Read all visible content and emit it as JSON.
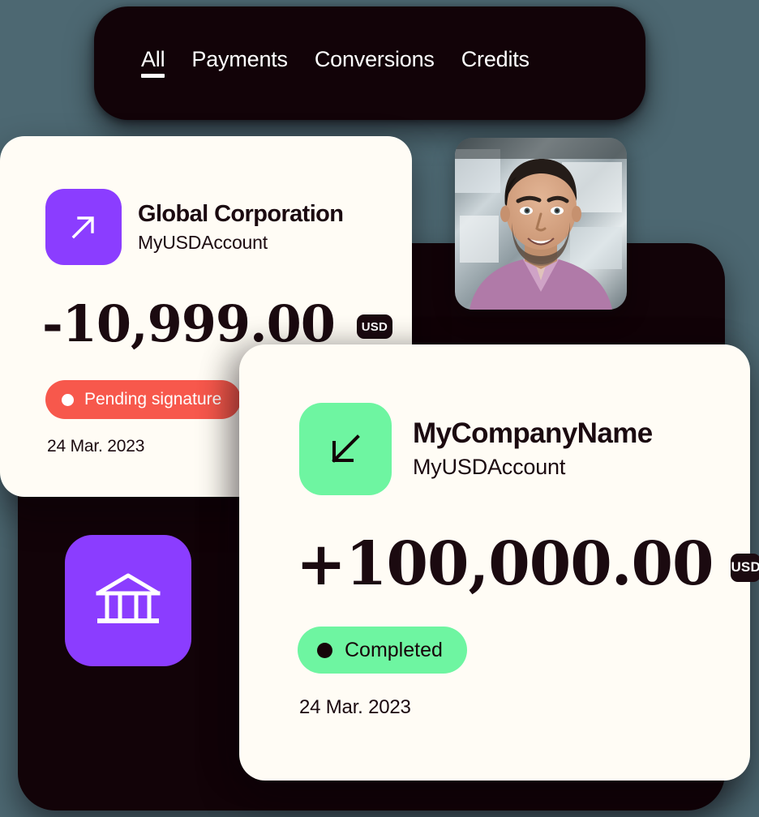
{
  "background_color": "#4d6872",
  "panel_color": "#120308",
  "card_color": "#fffcf5",
  "tabs": [
    {
      "label": "All",
      "active": true
    },
    {
      "label": "Payments",
      "active": false
    },
    {
      "label": "Conversions",
      "active": false
    },
    {
      "label": "Credits",
      "active": false
    }
  ],
  "transactions": [
    {
      "direction_icon": "arrow-up-right-icon",
      "icon_color": "#8b3dff",
      "party": "Global Corporation",
      "account": "MyUSDAccount",
      "amount": "-10,999.00",
      "currency": "USD",
      "status": "Pending signature",
      "status_color": "#f7584c",
      "date": "24 Mar. 2023"
    },
    {
      "direction_icon": "arrow-down-left-icon",
      "icon_color": "#6ef5a1",
      "party": "MyCompanyName",
      "account": "MyUSDAccount",
      "amount": "+100,000.00",
      "currency": "USD",
      "status": "Completed",
      "status_color": "#6ef5a1",
      "date": "24 Mar. 2023"
    }
  ],
  "bank_tile": {
    "icon": "bank-building-icon",
    "color": "#8b3dff"
  },
  "avatar": {
    "icon": "user-portrait-photo",
    "description": "Smiling man with short dark hair and beard wearing a mauve shirt"
  }
}
